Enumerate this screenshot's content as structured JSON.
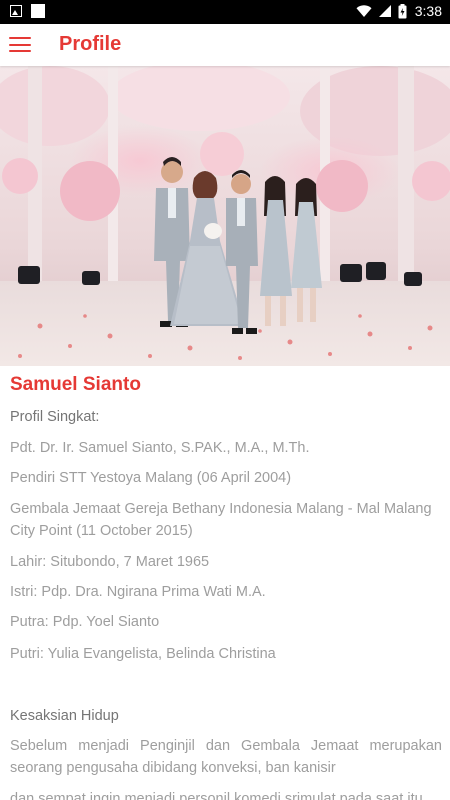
{
  "status_bar": {
    "time": "3:38",
    "icons": [
      "photo-icon",
      "square-icon",
      "wifi-icon",
      "signal-icon",
      "battery-icon"
    ]
  },
  "app_bar": {
    "title": "Profile",
    "menu_icon": "hamburger-menu-icon"
  },
  "colors": {
    "accent": "#e53935",
    "text_muted": "#9e9e9e",
    "text_label": "#757575"
  },
  "profile": {
    "name": "Samuel Sianto",
    "brief_heading": "Profil Singkat:",
    "lines": [
      "Pdt. Dr. Ir. Samuel Sianto, S.PAK., M.A., M.Th.",
      "Pendiri STT Yestoya Malang (06 April 2004)",
      "Gembala Jemaat Gereja Bethany Indonesia Malang - Mal Malang City Point (11 October 2015)",
      "Lahir: Situbondo, 7 Maret 1965",
      "Istri: Pdp. Dra. Ngirana Prima Wati M.A.",
      "Putra: Pdp. Yoel Sianto",
      "Putri: Yulia Evangelista, Belinda Christina"
    ],
    "testimony_heading": "Kesaksian Hidup",
    "testimony_text": "Sebelum menjadi Penginjil dan Gembala Jemaat merupakan seorang pengusaha dibidang konveksi, ban kanisir",
    "testimony_cut": "dan sempat ingin menjadi personil komedi srimulat pada saat itu"
  }
}
